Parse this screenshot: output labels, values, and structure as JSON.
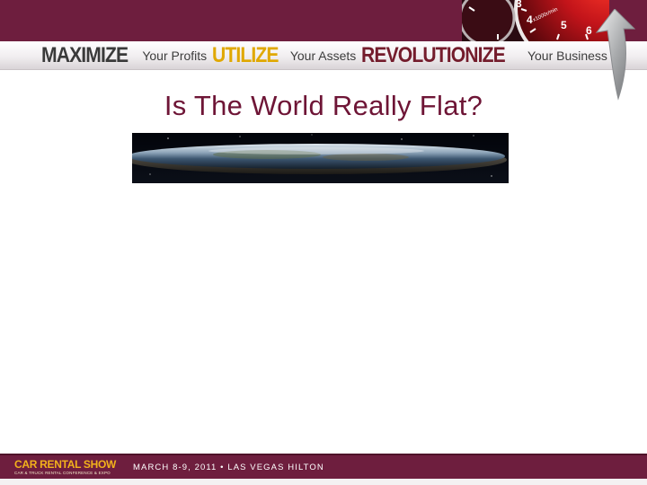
{
  "header": {
    "tagline": [
      {
        "strong": "MAXIMIZE",
        "light": "Your Profits",
        "color": "#3a3a3a"
      },
      {
        "strong": "UTILIZE",
        "light": "Your Assets",
        "color": "#e0a800"
      },
      {
        "strong": "REVOLUTIONIZE",
        "light": "Your Business",
        "color": "#741c2c"
      }
    ],
    "gauge_marks": [
      "3",
      "4",
      "x1000r/min",
      "5",
      "6"
    ]
  },
  "slide": {
    "title": "Is The World Really Flat?"
  },
  "footer": {
    "brand_name": "CAR RENTAL SHOW",
    "brand_sub": "CAR & TRUCK RENTAL CONFERENCE & EXPO",
    "event": "MARCH 8-9, 2011 • LAS VEGAS HILTON"
  },
  "colors": {
    "brand_maroon": "#6e1e3e",
    "title_color": "#6e1536",
    "accent_gold": "#f2b21b"
  }
}
